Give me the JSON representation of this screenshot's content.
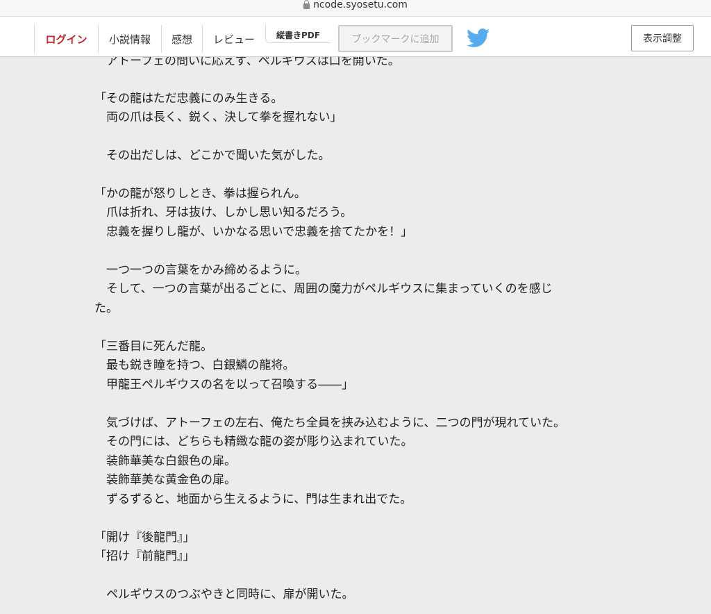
{
  "browser": {
    "url": "ncode.syosetu.com"
  },
  "nav": {
    "login": "ログイン",
    "novel_info": "小説情報",
    "impressions": "感想",
    "review": "レビュー",
    "vertical_pdf": "縦書きPDF",
    "bookmark": "ブックマークに追加",
    "display_settings": "表示調整",
    "colors": {
      "login": "#c8232a",
      "twitter": "#55acee"
    }
  },
  "content": {
    "lines": [
      "　アトーフェの問いに応えず、ペルギウスは口を開いた。",
      "",
      "「その龍はただ忠義にのみ生きる。",
      "　両の爪は長く、鋭く、決して拳を握れない」",
      "",
      "　その出だしは、どこかで聞いた気がした。",
      "",
      "「かの龍が怒りしとき、拳は握られん。",
      "　爪は折れ、牙は抜け、しかし思い知るだろう。",
      "　忠義を握りし龍が、いかなる思いで忠義を捨てたかを！」",
      "",
      "　一つ一つの言葉をかみ締めるように。",
      "　そして、一つの言葉が出るごとに、周囲の魔力がペルギウスに集まっていくのを感じ",
      "た。",
      "",
      "「三番目に死んだ龍。",
      "　最も鋭き瞳を持つ、白銀鱗の龍将。",
      "　甲龍王ペルギウスの名を以って召喚する――」",
      "",
      "　気づけば、アトーフェの左右、俺たち全員を挟み込むように、二つの門が現れていた。",
      "　その門には、どちらも精緻な龍の姿が彫り込まれていた。",
      "　装飾華美な白銀色の扉。",
      "　装飾華美な黄金色の扉。",
      "　ずるずると、地面から生えるように、門は生まれ出でた。",
      "",
      "「開け『後龍門』」",
      "「招け『前龍門』」",
      "",
      "　ペルギウスのつぶやきと同時に、扉が開いた。"
    ]
  }
}
